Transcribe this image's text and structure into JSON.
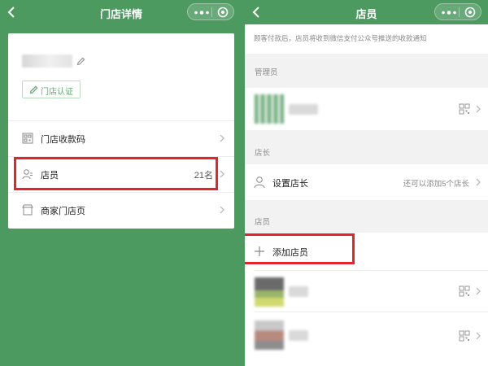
{
  "left": {
    "nav": {
      "title": "门店详情"
    },
    "store": {
      "cert_label": "门店认证"
    },
    "menu": [
      {
        "label": "门店收款码",
        "value": ""
      },
      {
        "label": "店员",
        "value": "21名"
      },
      {
        "label": "商家门店页",
        "value": ""
      }
    ]
  },
  "right": {
    "nav": {
      "title": "店员"
    },
    "notice": "顾客付款后，店员将收到微信支付公众号推送的收款通知",
    "admin_section": {
      "title": "管理员"
    },
    "manager_section": {
      "title": "店长",
      "set_label": "设置店长",
      "hint": "还可以添加5个店长"
    },
    "staff_section": {
      "title": "店员",
      "add_label": "添加店员"
    }
  },
  "colors": {
    "brand_green": "#4d9a61",
    "highlight_red": "#e8222a"
  }
}
